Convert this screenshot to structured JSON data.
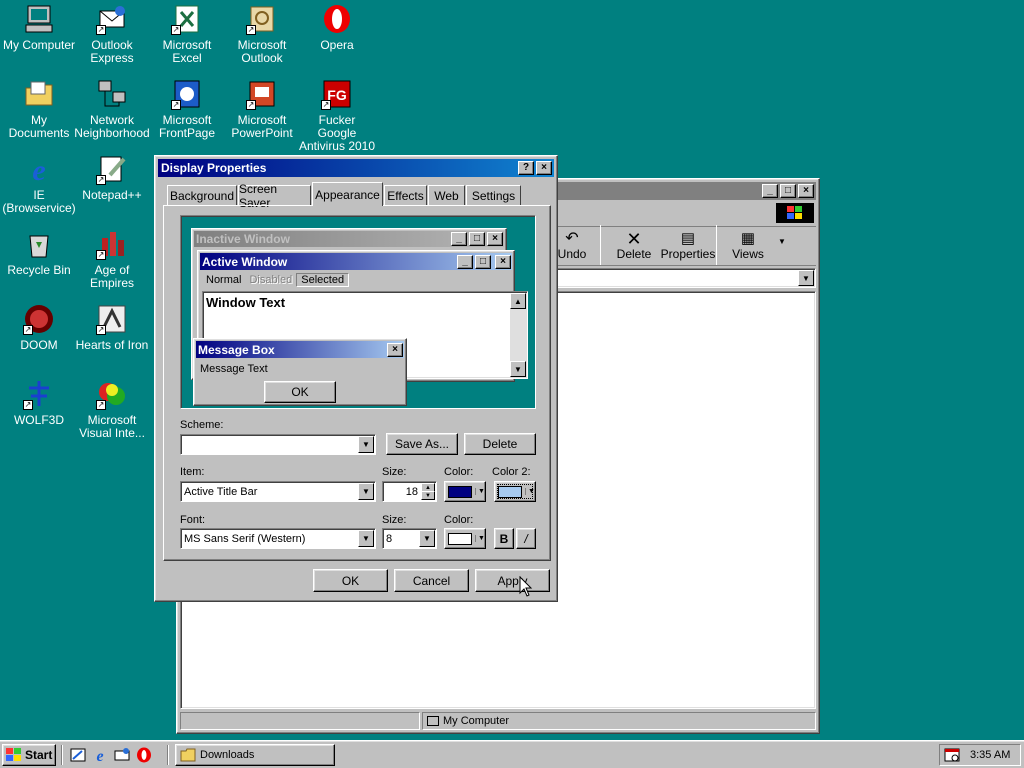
{
  "desktop": {
    "icons": [
      {
        "label1": "My Computer",
        "label2": "",
        "icon": "my-computer-icon"
      },
      {
        "label1": "Outlook",
        "label2": "Express",
        "icon": "outlook-express-icon"
      },
      {
        "label1": "Microsoft",
        "label2": "Excel",
        "icon": "excel-icon"
      },
      {
        "label1": "Microsoft",
        "label2": "Outlook",
        "icon": "outlook-icon"
      },
      {
        "label1": "Opera",
        "label2": "",
        "icon": "opera-icon"
      },
      {
        "label1": "My Documents",
        "label2": "",
        "icon": "my-documents-icon"
      },
      {
        "label1": "Network",
        "label2": "Neighborhood",
        "icon": "network-icon"
      },
      {
        "label1": "Microsoft",
        "label2": "FrontPage",
        "icon": "frontpage-icon"
      },
      {
        "label1": "Microsoft",
        "label2": "PowerPoint",
        "icon": "powerpoint-icon"
      },
      {
        "label1": "Fucker Google",
        "label2": "Antivirus 2010",
        "icon": "antivirus-icon"
      },
      {
        "label1": "IE",
        "label2": "(Browservice)",
        "icon": "ie-icon"
      },
      {
        "label1": "Notepad++",
        "label2": "",
        "icon": "notepad-icon"
      },
      {
        "label1": "Recycle Bin",
        "label2": "",
        "icon": "recycle-bin-icon"
      },
      {
        "label1": "Age of Empires",
        "label2": "",
        "icon": "age-of-empires-icon"
      },
      {
        "label1": "DOOM",
        "label2": "",
        "icon": "doom-icon"
      },
      {
        "label1": "Hearts of Iron",
        "label2": "",
        "icon": "hearts-of-iron-icon"
      },
      {
        "label1": "WOLF3D",
        "label2": "",
        "icon": "wolf3d-icon"
      },
      {
        "label1": "Microsoft",
        "label2": "Visual Inte...",
        "icon": "visual-interdev-icon"
      }
    ]
  },
  "explorer": {
    "toolbar": {
      "undo": "Undo",
      "delete": "Delete",
      "properties": "Properties",
      "views": "Views"
    },
    "status": "My Computer"
  },
  "dialog": {
    "title": "Display Properties",
    "help": "?",
    "close": "×",
    "tabs": [
      "Background",
      "Screen Saver",
      "Appearance",
      "Effects",
      "Web",
      "Settings"
    ],
    "preview": {
      "inactive_title": "Inactive Window",
      "active_title": "Active Window",
      "menu_normal": "Normal",
      "menu_disabled": "Disabled",
      "menu_selected": "Selected",
      "window_text": "Window Text",
      "msgbox_title": "Message Box",
      "msgbox_text": "Message Text",
      "msgbox_ok": "OK"
    },
    "scheme_label": "Scheme:",
    "scheme_value": "",
    "save_as": "Save As...",
    "delete": "Delete",
    "item_label": "Item:",
    "item_value": "Active Title Bar",
    "size_label": "Size:",
    "size_value": "18",
    "color_label": "Color:",
    "color2_label": "Color 2:",
    "font_label": "Font:",
    "font_value": "MS Sans Serif (Western)",
    "font_size_label": "Size:",
    "font_size_value": "8",
    "font_color_label": "Color:",
    "bold": "B",
    "italic": "/",
    "ok": "OK",
    "cancel": "Cancel",
    "apply": "Apply",
    "colors": {
      "color1": "#000080",
      "color2": "#a6caf0",
      "font_color": "#ffffff"
    }
  },
  "taskbar": {
    "start": "Start",
    "task": "Downloads",
    "time": "3:35 AM"
  }
}
